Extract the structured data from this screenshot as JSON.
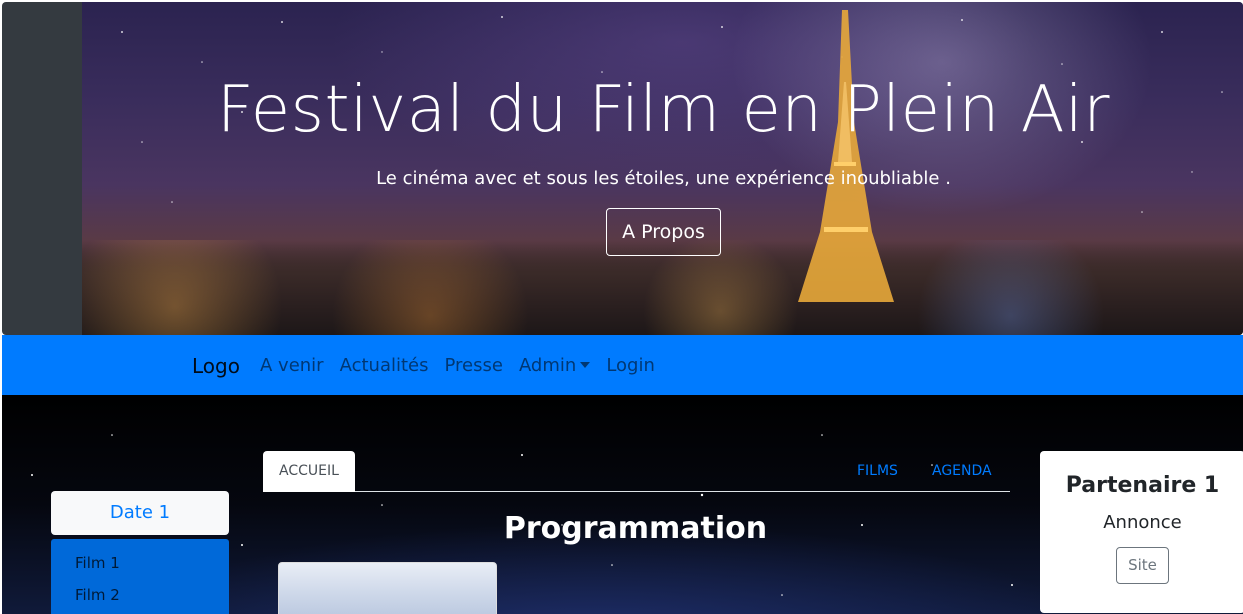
{
  "hero": {
    "title": "Festival du Film en Plein Air",
    "subtitle": "Le cinéma avec et sous les étoiles, une expérience inoubliable .",
    "button_label": "A Propos"
  },
  "navbar": {
    "logo": "Logo",
    "links": [
      "A venir",
      "Actualités",
      "Presse",
      "Admin",
      "Login"
    ],
    "background": "#007bff"
  },
  "sidebar": {
    "date_label": "Date 1",
    "films": [
      "Film 1",
      "Film 2"
    ]
  },
  "tabs": {
    "active": "ACCUEIL",
    "right": [
      "FILMS",
      "AGENDA"
    ]
  },
  "main": {
    "title": "Programmation"
  },
  "partner": {
    "title": "Partenaire 1",
    "text": "Annonce",
    "button_label": "Site"
  }
}
